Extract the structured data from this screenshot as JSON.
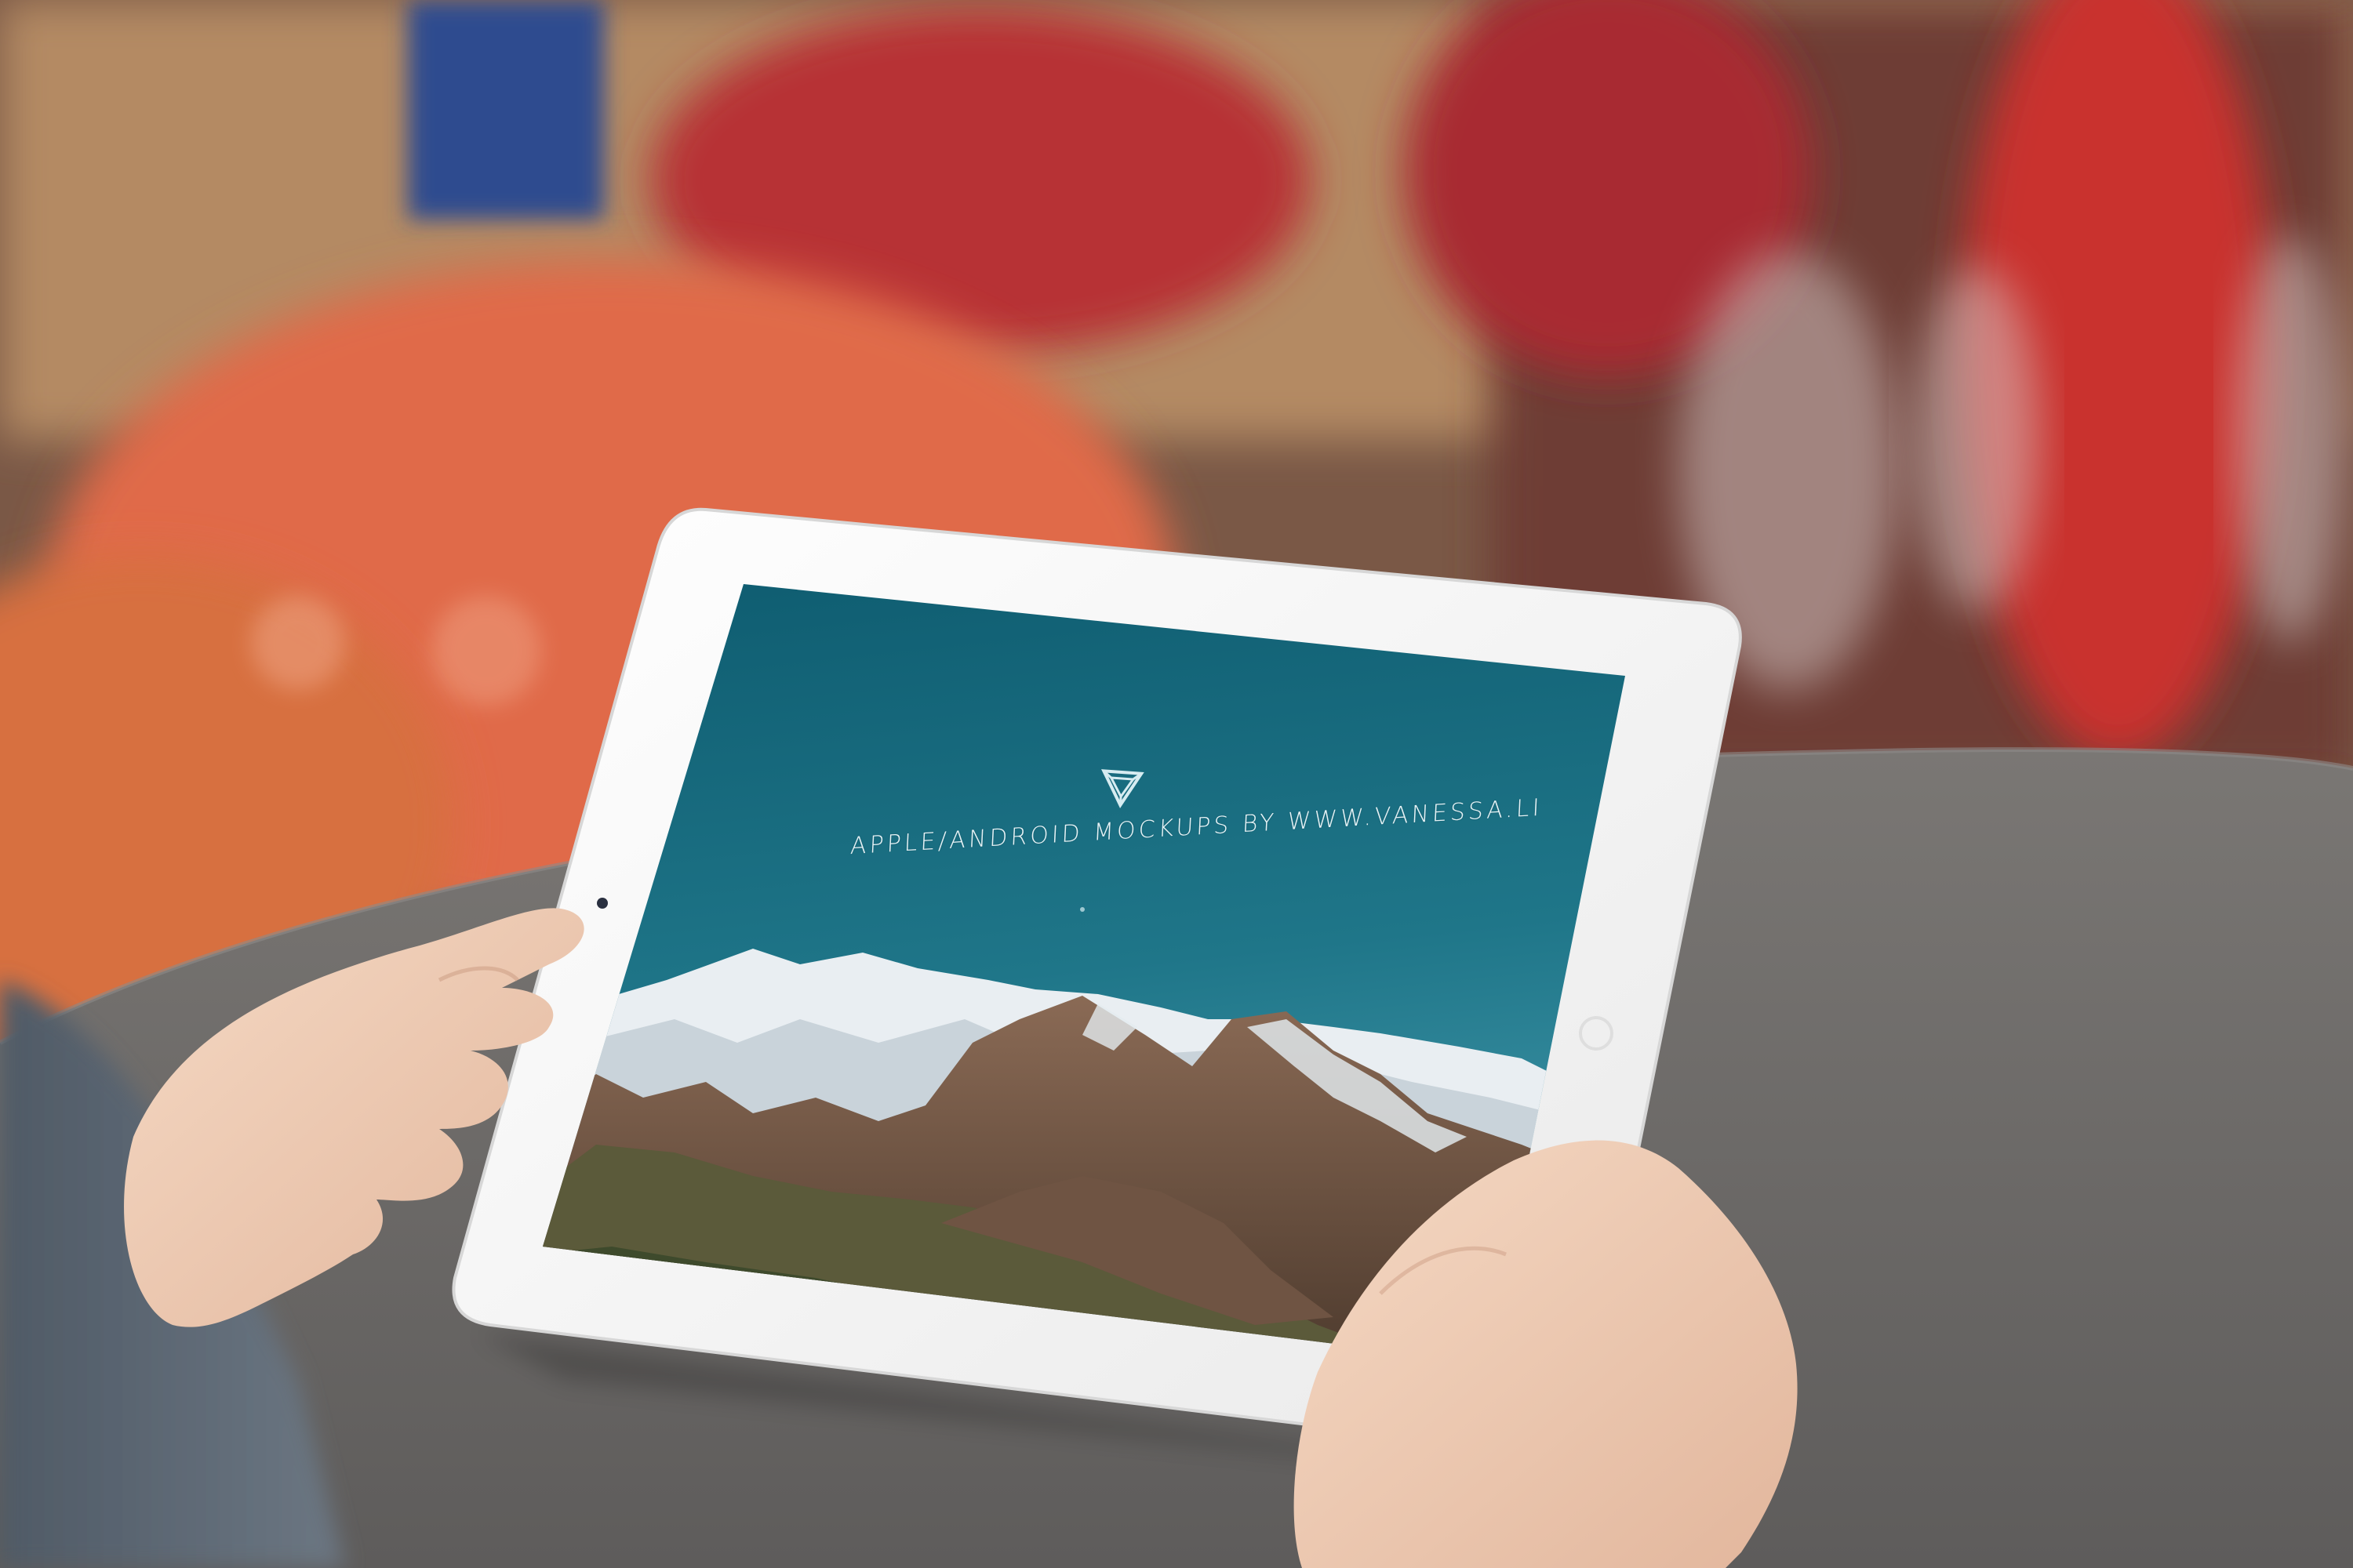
{
  "tablet": {
    "screen": {
      "caption": "APPLE/ANDROID MOCKUPS BY WWW.VANESSA.LI",
      "logo_icon": "impossible-triangle-icon"
    }
  },
  "colors": {
    "sky_top": "#0f5f73",
    "sky_bottom": "#3d93a6",
    "tablet_bezel": "#f7f7f7",
    "table_surface": "#6b6968",
    "background_red": "#c4322c"
  }
}
